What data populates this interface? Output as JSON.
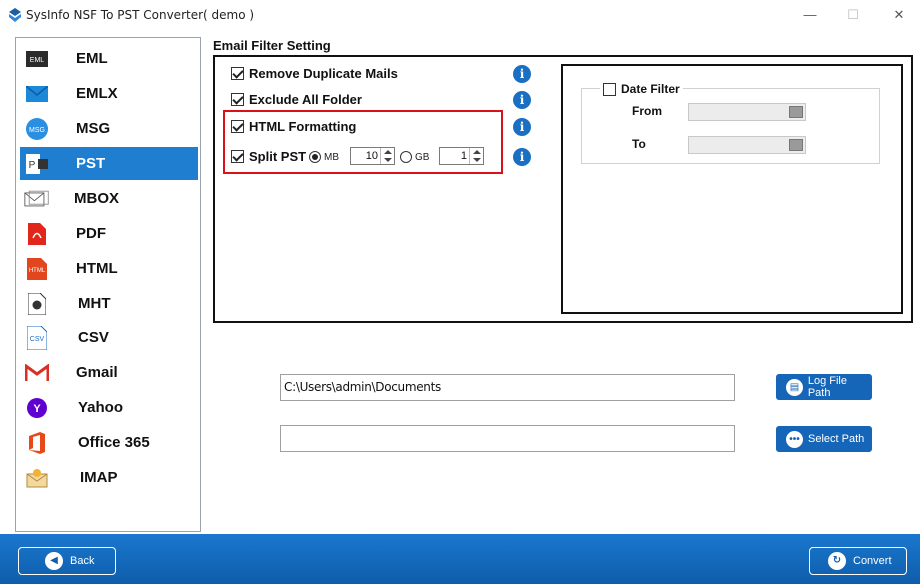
{
  "window": {
    "title": "SysInfo NSF To PST Converter( demo )",
    "minimize": "—",
    "maximize": "☐",
    "close": "✕"
  },
  "sidebar": {
    "items": [
      {
        "label": "EML",
        "icon": "eml-icon"
      },
      {
        "label": "EMLX",
        "icon": "emlx-icon"
      },
      {
        "label": "MSG",
        "icon": "msg-icon"
      },
      {
        "label": "PST",
        "icon": "pst-icon",
        "active": true
      },
      {
        "label": "MBOX",
        "icon": "mbox-icon"
      },
      {
        "label": "PDF",
        "icon": "pdf-icon"
      },
      {
        "label": "HTML",
        "icon": "html-icon"
      },
      {
        "label": "MHT",
        "icon": "mht-icon"
      },
      {
        "label": "CSV",
        "icon": "csv-icon"
      },
      {
        "label": "Gmail",
        "icon": "gmail-icon"
      },
      {
        "label": "Yahoo",
        "icon": "yahoo-icon"
      },
      {
        "label": "Office 365",
        "icon": "office365-icon"
      },
      {
        "label": "IMAP",
        "icon": "imap-icon"
      }
    ],
    "icon_text": {
      "eml": "EML",
      "msg": "MSG",
      "html": "HTML",
      "csv": "CSV"
    }
  },
  "filter": {
    "section_title": "Email Filter Setting",
    "remove_duplicates": "Remove Duplicate Mails",
    "exclude_all_folder": "Exclude All Folder",
    "html_formatting": "HTML Formatting",
    "split_pst": "Split PST",
    "mb_label": "MB",
    "mb_value": "10",
    "gb_label": "GB",
    "gb_value": "1",
    "info_glyph": "i"
  },
  "date_filter": {
    "label": "Date Filter",
    "from_label": "From",
    "to_label": "To"
  },
  "paths": {
    "log_path_value": "C:\\Users\\admin\\Documents",
    "log_button": "Log File Path",
    "select_path_value": "",
    "select_button": "Select Path"
  },
  "footer": {
    "back": "Back",
    "convert": "Convert"
  },
  "colors": {
    "accent": "#1f7ecf",
    "highlight_border": "#d9121a",
    "footer": "#1a78cf"
  }
}
